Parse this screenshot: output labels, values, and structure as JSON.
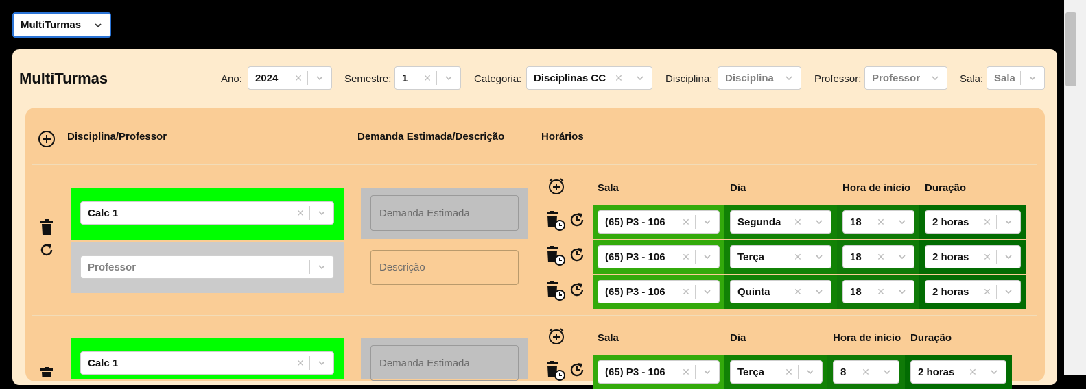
{
  "top_select": {
    "value": "MultiTurmas"
  },
  "title": "MultiTurmas",
  "filters": {
    "ano": {
      "label": "Ano:",
      "value": "2024"
    },
    "semestre": {
      "label": "Semestre:",
      "value": "1"
    },
    "categoria": {
      "label": "Categoria:",
      "value": "Disciplinas CC"
    },
    "disciplina": {
      "label": "Disciplina:",
      "placeholder": "Disciplina"
    },
    "professor": {
      "label": "Professor:",
      "placeholder": "Professor"
    },
    "sala": {
      "label": "Sala:",
      "placeholder": "Sala"
    }
  },
  "columns": {
    "disciplina_professor": "Disciplina/Professor",
    "demanda_descricao": "Demanda Estimada/Descrição",
    "horarios": "Horários"
  },
  "schedule_headers": {
    "sala": "Sala",
    "dia": "Dia",
    "hora": "Hora de início",
    "duracao": "Duração"
  },
  "turmas": [
    {
      "disciplina": "Calc 1",
      "professor_placeholder": "Professor",
      "demanda_placeholder": "Demanda Estimada",
      "descricao_placeholder": "Descrição",
      "horarios": [
        {
          "sala": "(65) P3 - 106",
          "dia": "Segunda",
          "hora": "18",
          "duracao": "2 horas"
        },
        {
          "sala": "(65) P3 - 106",
          "dia": "Terça",
          "hora": "18",
          "duracao": "2 horas"
        },
        {
          "sala": "(65) P3 - 106",
          "dia": "Quinta",
          "hora": "18",
          "duracao": "2 horas"
        }
      ]
    },
    {
      "disciplina": "Calc 1",
      "demanda_placeholder": "Demanda Estimada",
      "horarios": [
        {
          "sala": "(65) P3 - 106",
          "dia": "Terça",
          "hora": "8",
          "duracao": "2 horas"
        }
      ]
    }
  ],
  "colors": {
    "page_bg": "#000000",
    "panel_bg": "#feebcd",
    "card_bg": "#facd96",
    "disciplina_highlight": "#00ff00",
    "grey_block": "#c0c0c0",
    "sala_green": "#33aa0b",
    "dia_green": "#118205",
    "hora_green": "#0f7a07",
    "duracao_green": "#026c02"
  }
}
